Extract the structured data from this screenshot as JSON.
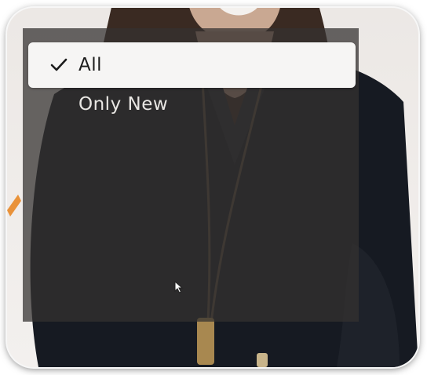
{
  "filter_menu": {
    "items": [
      {
        "label": "All",
        "selected": true,
        "icon": "checkmark-icon"
      },
      {
        "label": "Only New",
        "selected": false
      }
    ]
  },
  "background": {
    "description_icon": "video-frame"
  },
  "colors": {
    "overlay": "#343230",
    "selected_bg": "#f6f5f4",
    "selected_text": "#1c1c1c",
    "item_text": "#e9e7e4"
  },
  "cursor_icon": "mouse-pointer-icon"
}
